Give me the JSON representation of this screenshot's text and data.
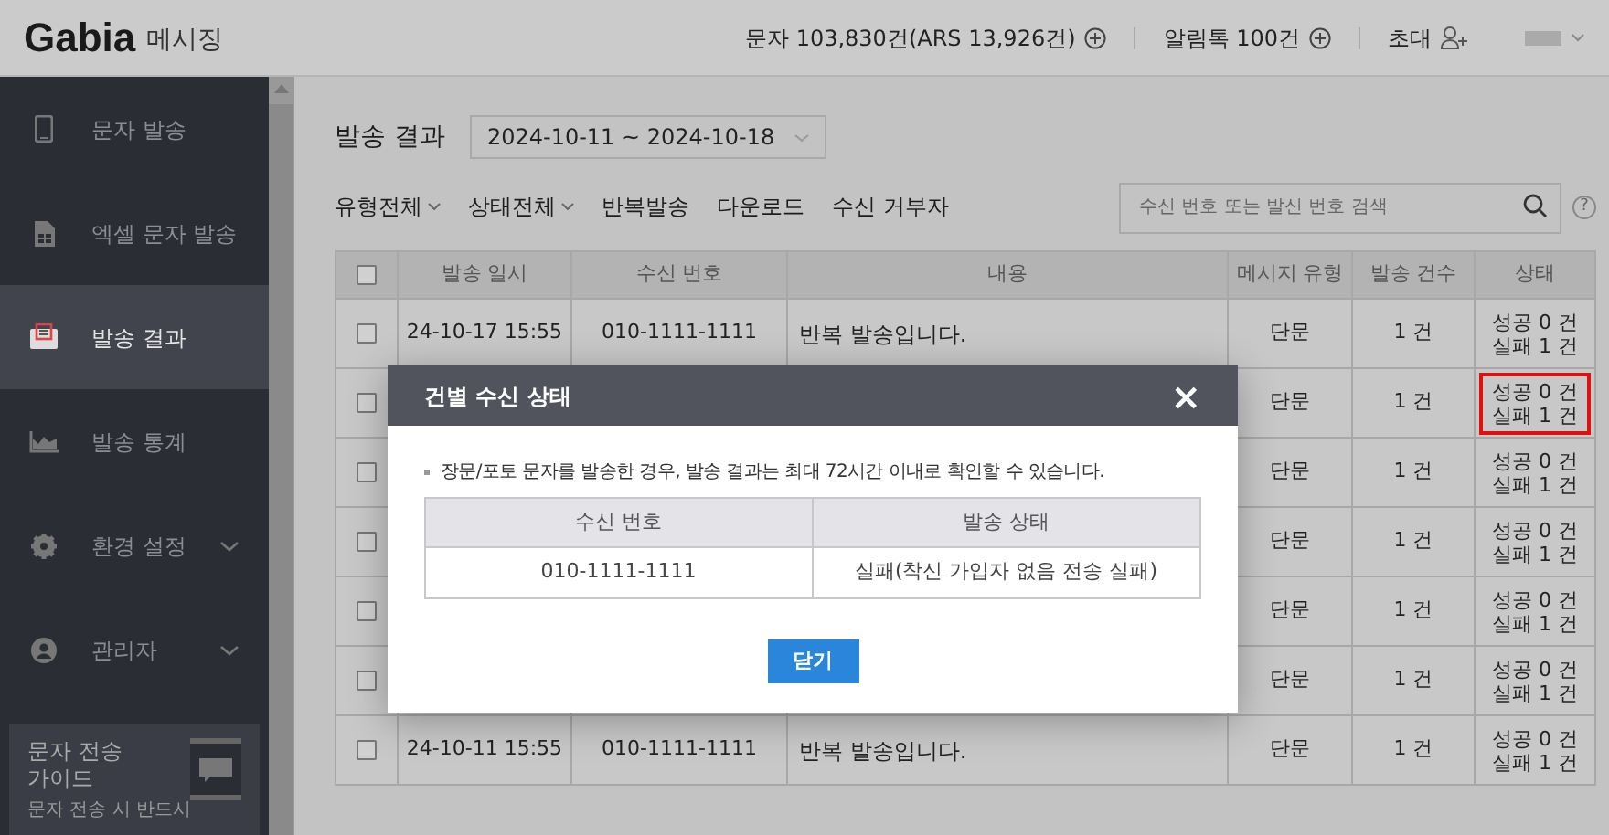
{
  "header": {
    "logo": "Gabia",
    "service": "메시징",
    "credits": "문자 103,830건(ARS 13,926건)",
    "alimtalk": "알림톡 100건",
    "invite": "초대"
  },
  "sidebar": {
    "items": [
      {
        "label": "문자 발송",
        "selected": false
      },
      {
        "label": "엑셀 문자 발송",
        "selected": false
      },
      {
        "label": "발송 결과",
        "selected": true
      },
      {
        "label": "발송 통계",
        "selected": false
      },
      {
        "label": "환경 설정",
        "selected": false,
        "expanded": false
      },
      {
        "label": "관리자",
        "selected": false,
        "expanded": false
      }
    ],
    "guide": {
      "title": "문자 전송 가이드",
      "text": "문자 전송 시 반드시"
    }
  },
  "page": {
    "title": "발송 결과",
    "date_range": "2024-10-11 ~ 2024-10-18"
  },
  "toolbar": {
    "items": [
      {
        "label": "유형전체",
        "kind": "dropdown"
      },
      {
        "label": "상태전체",
        "kind": "dropdown"
      },
      {
        "label": "반복발송",
        "kind": "link"
      },
      {
        "label": "다운로드",
        "kind": "link"
      },
      {
        "label": "수신 거부자",
        "kind": "link"
      }
    ],
    "search": {
      "placeholder": "수신 번호 또는 발신 번호 검색"
    },
    "help": "?"
  },
  "table": {
    "select_all_checked": false,
    "columns": [
      "발송 일시",
      "수신 번호",
      "내용",
      "메시지 유형",
      "발송 건수",
      "상태"
    ],
    "rows": [
      {
        "checked": false,
        "date": "24-10-17 15:55",
        "number": "010-1111-1111",
        "content": "반복 발송입니다.",
        "type": "단문",
        "count": "1 건",
        "success": "성공 0 건",
        "fail": "실패 1 건",
        "highlighted": false
      },
      {
        "checked": false,
        "type": "단문",
        "count": "1 건",
        "success": "성공 0 건",
        "fail": "실패 1 건",
        "highlighted": true
      },
      {
        "checked": false,
        "type": "단문",
        "count": "1 건",
        "success": "성공 0 건",
        "fail": "실패 1 건",
        "highlighted": false
      },
      {
        "checked": false,
        "type": "단문",
        "count": "1 건",
        "success": "성공 0 건",
        "fail": "실패 1 건",
        "highlighted": false
      },
      {
        "checked": false,
        "type": "단문",
        "count": "1 건",
        "success": "성공 0 건",
        "fail": "실패 1 건",
        "highlighted": false
      },
      {
        "checked": false,
        "type": "단문",
        "count": "1 건",
        "success": "성공 0 건",
        "fail": "실패 1 건",
        "highlighted": false
      },
      {
        "checked": false,
        "date": "24-10-11 15:55",
        "number": "010-1111-1111",
        "content": "반복 발송입니다.",
        "type": "단문",
        "count": "1 건",
        "success": "성공 0 건",
        "fail": "실패 1 건",
        "highlighted": false
      }
    ]
  },
  "dialog": {
    "title": "건별 수신 상태",
    "close": "×",
    "note": "장문/포토 문자를 발송한 경우, 발송 결과는 최대 72시간 이내로 확인할 수 있습니다.",
    "columns": [
      "수신 번호",
      "발송 상태"
    ],
    "rows": [
      [
        "010-1111-1111",
        "실패(착신 가입자 없음 전송 실패)"
      ]
    ],
    "button": "닫기"
  }
}
